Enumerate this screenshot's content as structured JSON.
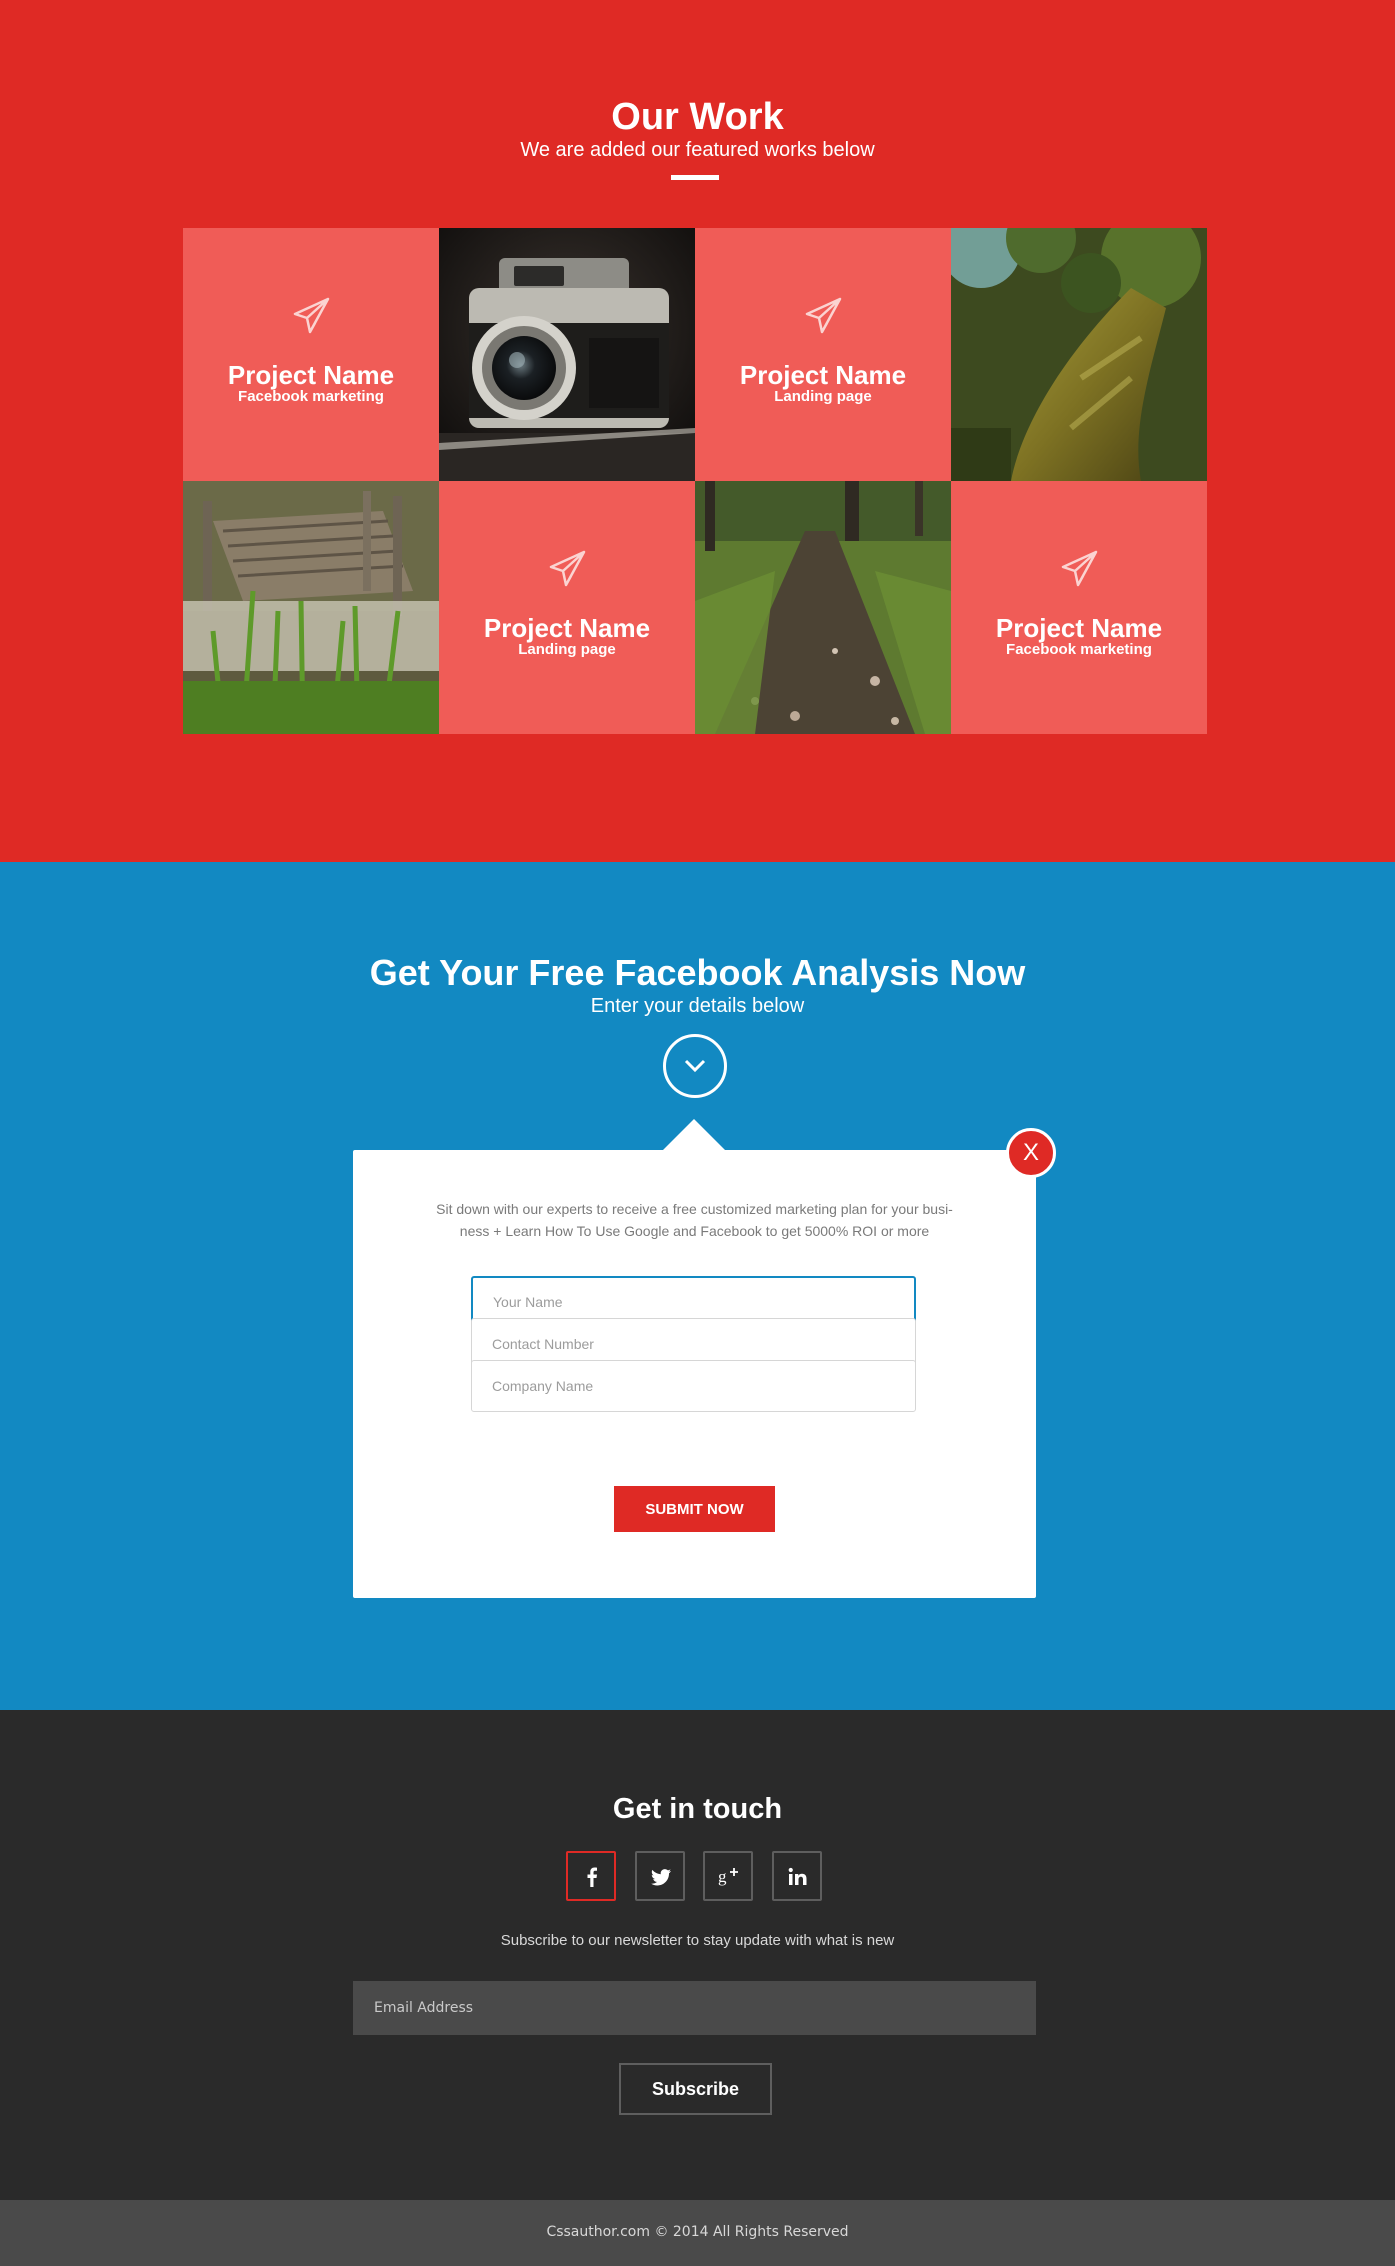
{
  "work": {
    "title": "Our Work",
    "subtitle": "We are added our featured works below",
    "tiles": [
      {
        "kind": "card",
        "name": "Project Name",
        "type": "Facebook marketing",
        "icon": "paper-plane-icon"
      },
      {
        "kind": "photo",
        "subject": "camera"
      },
      {
        "kind": "card",
        "name": "Project Name",
        "type": "Landing page",
        "icon": "paper-plane-icon"
      },
      {
        "kind": "photo",
        "subject": "mossy-tree"
      },
      {
        "kind": "photo",
        "subject": "wooden-pier"
      },
      {
        "kind": "card",
        "name": "Project Name",
        "type": "Landing page",
        "icon": "paper-plane-icon"
      },
      {
        "kind": "photo",
        "subject": "forest-path"
      },
      {
        "kind": "card",
        "name": "Project Name",
        "type": "Facebook marketing",
        "icon": "paper-plane-icon"
      }
    ]
  },
  "analysis": {
    "title": "Get Your Free Facebook Analysis Now",
    "subtitle": "Enter your details below",
    "description_line1": "Sit down with our experts to receive a free customized marketing plan for your busi-",
    "description_line2": "ness + Learn How To Use Google and Facebook to get 5000% ROI or more",
    "close_label": "X",
    "fields": {
      "name_placeholder": "Your Name",
      "contact_placeholder": "Contact Number",
      "company_placeholder": "Company Name"
    },
    "submit_label": "SUBMIT NOW"
  },
  "contact": {
    "title": "Get in touch",
    "social": [
      "facebook-icon",
      "twitter-icon",
      "google-plus-icon",
      "linkedin-icon"
    ],
    "newsletter_text": "Subscribe to our newsletter to stay update with what is new",
    "email_placeholder": "Email Address",
    "subscribe_label": "Subscribe"
  },
  "footer": {
    "copyright": "Cssauthor.com © 2014 All Rights Reserved"
  },
  "colors": {
    "red": "#df2a25",
    "card_red": "#f05c57",
    "blue": "#1289c2",
    "dark": "#2a2a2a",
    "footer": "#4a4a4a"
  }
}
